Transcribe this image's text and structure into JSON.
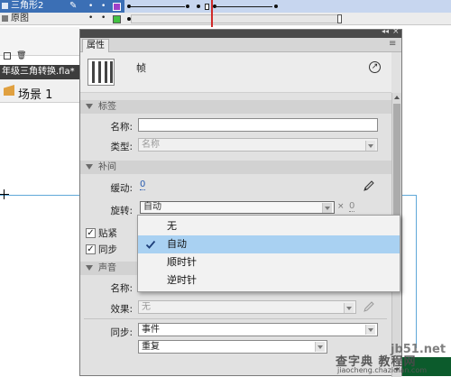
{
  "timeline": {
    "layers": [
      {
        "name": "三角形2",
        "color": "#a040c8"
      },
      {
        "name": "原图",
        "color": "#42c242"
      }
    ]
  },
  "document": {
    "tab_title": "年级三角转换.fla*",
    "close_glyph": "×",
    "scene_label": "场景 1"
  },
  "panel": {
    "tab_label": "属性",
    "collapse_glyph": "◂◂",
    "close_glyph": "×",
    "menu_glyph": "≡",
    "header_title": "帧",
    "sections": {
      "label": "标签",
      "tween": "补间",
      "sound": "声音"
    },
    "name_label": "名称:",
    "name_value": "",
    "type_label": "类型:",
    "type_value": "名称",
    "ease_label": "缓动:",
    "ease_value": "0",
    "rotate_label": "旋转:",
    "rotate_value": "自动",
    "rotate_times_sign": "×",
    "rotate_times_value": "0",
    "snap_label": "贴紧",
    "snap_checked": true,
    "sync_checkbox_label": "同步",
    "sync_checked": true,
    "sound_name_label": "名称:",
    "effect_label": "效果:",
    "effect_value": "无",
    "sync_label": "同步:",
    "sync_value": "事件",
    "repeat_value": "重复"
  },
  "dropdown": {
    "items": [
      {
        "label": "无",
        "selected": false
      },
      {
        "label": "自动",
        "selected": true
      },
      {
        "label": "顺时针",
        "selected": false
      },
      {
        "label": "逆时针",
        "selected": false
      }
    ]
  },
  "watermark": {
    "site": "jb51.net",
    "name": "查字典 教程网",
    "url": "jiaocheng.chazidian.com"
  }
}
